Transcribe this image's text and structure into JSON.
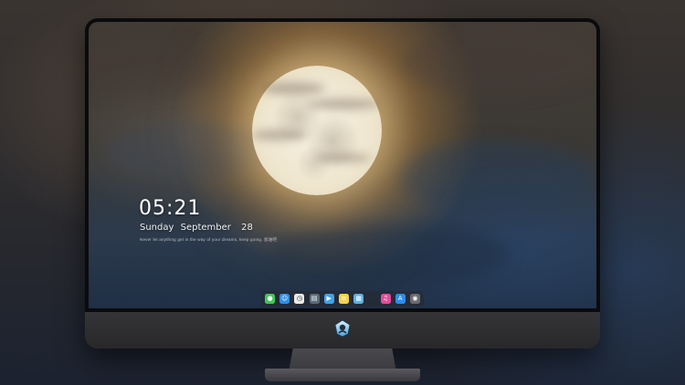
{
  "lock_screen": {
    "time": "05:21",
    "day": "Sunday",
    "month": "September",
    "date": "28",
    "note": "Never let anything get in the way of your dreams, keep going. 加油吧"
  },
  "dock": {
    "icons": [
      {
        "name": "messages-icon",
        "color": "#3ec95a",
        "glyph": "●"
      },
      {
        "name": "finder-icon",
        "color": "#2f8ee6",
        "glyph": "☺"
      },
      {
        "name": "clock-icon",
        "color": "#e8e8e8",
        "glyph": "◷"
      },
      {
        "name": "media-icon",
        "color": "#5b6b7a",
        "glyph": "▤"
      },
      {
        "name": "video-icon",
        "color": "#3fa2e8",
        "glyph": "▶"
      },
      {
        "name": "notes-icon",
        "color": "#f3d34a",
        "glyph": "≡"
      },
      {
        "name": "photos-icon",
        "color": "#5cb0e0",
        "glyph": "▦"
      },
      {
        "name": "music-icon",
        "color": "#e24c9a",
        "glyph": "♫"
      },
      {
        "name": "app-store-icon",
        "color": "#2b8cf0",
        "glyph": "A"
      },
      {
        "name": "camera-icon",
        "color": "#6a6a70",
        "glyph": "◉"
      }
    ]
  },
  "colors": {
    "bezel": "#0b0b0d",
    "chin": "#2e2e31",
    "moon": "#f2ead6"
  }
}
